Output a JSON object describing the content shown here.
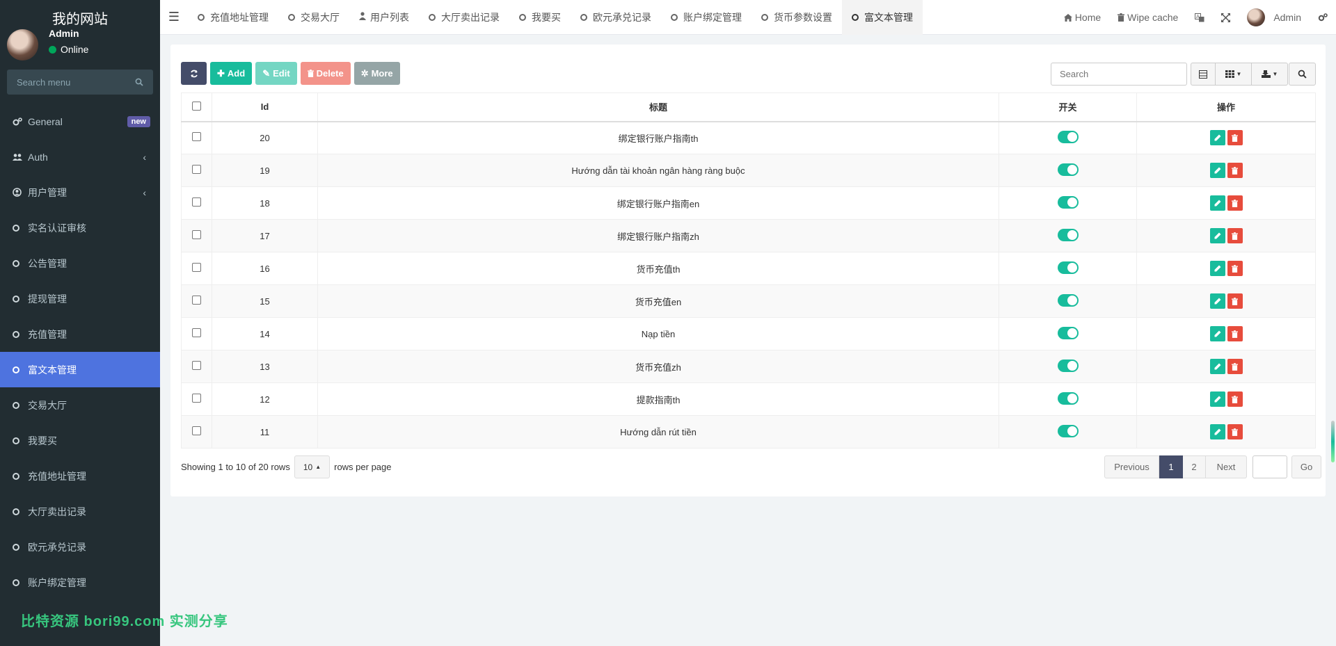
{
  "site": {
    "title": "我的网站"
  },
  "user": {
    "name": "Admin",
    "status": "Online"
  },
  "sidebar": {
    "search_placeholder": "Search menu",
    "items": [
      {
        "label": "General",
        "icon": "cogs-icon",
        "badge": "new"
      },
      {
        "label": "Auth",
        "icon": "group-icon"
      },
      {
        "label": "用户管理",
        "icon": "user-circle-icon"
      },
      {
        "label": "实名认证审核",
        "icon": "circle-icon"
      },
      {
        "label": "公告管理",
        "icon": "circle-icon"
      },
      {
        "label": "提现管理",
        "icon": "circle-icon"
      },
      {
        "label": "充值管理",
        "icon": "circle-icon"
      },
      {
        "label": "富文本管理",
        "icon": "circle-icon",
        "active": true
      },
      {
        "label": "交易大厅",
        "icon": "circle-icon"
      },
      {
        "label": "我要买",
        "icon": "circle-icon"
      },
      {
        "label": "充值地址管理",
        "icon": "circle-icon"
      },
      {
        "label": "大厅卖出记录",
        "icon": "circle-icon"
      },
      {
        "label": "欧元承兑记录",
        "icon": "circle-icon"
      },
      {
        "label": "账户绑定管理",
        "icon": "circle-icon"
      }
    ]
  },
  "tabs": [
    {
      "label": "充值地址管理"
    },
    {
      "label": "交易大厅"
    },
    {
      "label": "用户列表"
    },
    {
      "label": "大厅卖出记录"
    },
    {
      "label": "我要买"
    },
    {
      "label": "欧元承兑记录"
    },
    {
      "label": "账户绑定管理"
    },
    {
      "label": "货币参数设置"
    },
    {
      "label": "富文本管理"
    }
  ],
  "topright": {
    "home": "Home",
    "wipe": "Wipe cache",
    "admin": "Admin"
  },
  "toolbar": {
    "add": "Add",
    "edit": "Edit",
    "delete": "Delete",
    "more": "More",
    "search_placeholder": "Search"
  },
  "table": {
    "headers": {
      "id": "Id",
      "title": "标题",
      "switch": "开关",
      "ops": "操作"
    },
    "rows": [
      {
        "id": "20",
        "title": "绑定银行账户指南th"
      },
      {
        "id": "19",
        "title": "Hướng dẫn tài khoản ngân hàng ràng buộc"
      },
      {
        "id": "18",
        "title": "绑定银行账户指南en"
      },
      {
        "id": "17",
        "title": "绑定银行账户指南zh"
      },
      {
        "id": "16",
        "title": "货币充值th"
      },
      {
        "id": "15",
        "title": "货币充值en"
      },
      {
        "id": "14",
        "title": "Nạp tiền"
      },
      {
        "id": "13",
        "title": "货币充值zh"
      },
      {
        "id": "12",
        "title": "提款指南th"
      },
      {
        "id": "11",
        "title": "Hướng dẫn rút tiền"
      }
    ]
  },
  "footer": {
    "showing": "Showing 1 to 10 of 20 rows",
    "page_size": "10",
    "rows_per_page": "rows per page"
  },
  "pager": {
    "prev": "Previous",
    "p1": "1",
    "p2": "2",
    "next": "Next",
    "go": "Go"
  },
  "watermark": "比特资源 bori99.com 实测分享",
  "colors": {
    "accent": "#4e73df",
    "success": "#18bc9c",
    "danger": "#e74c3c",
    "sidebar": "#222d32",
    "primary_dark": "#444c69"
  }
}
